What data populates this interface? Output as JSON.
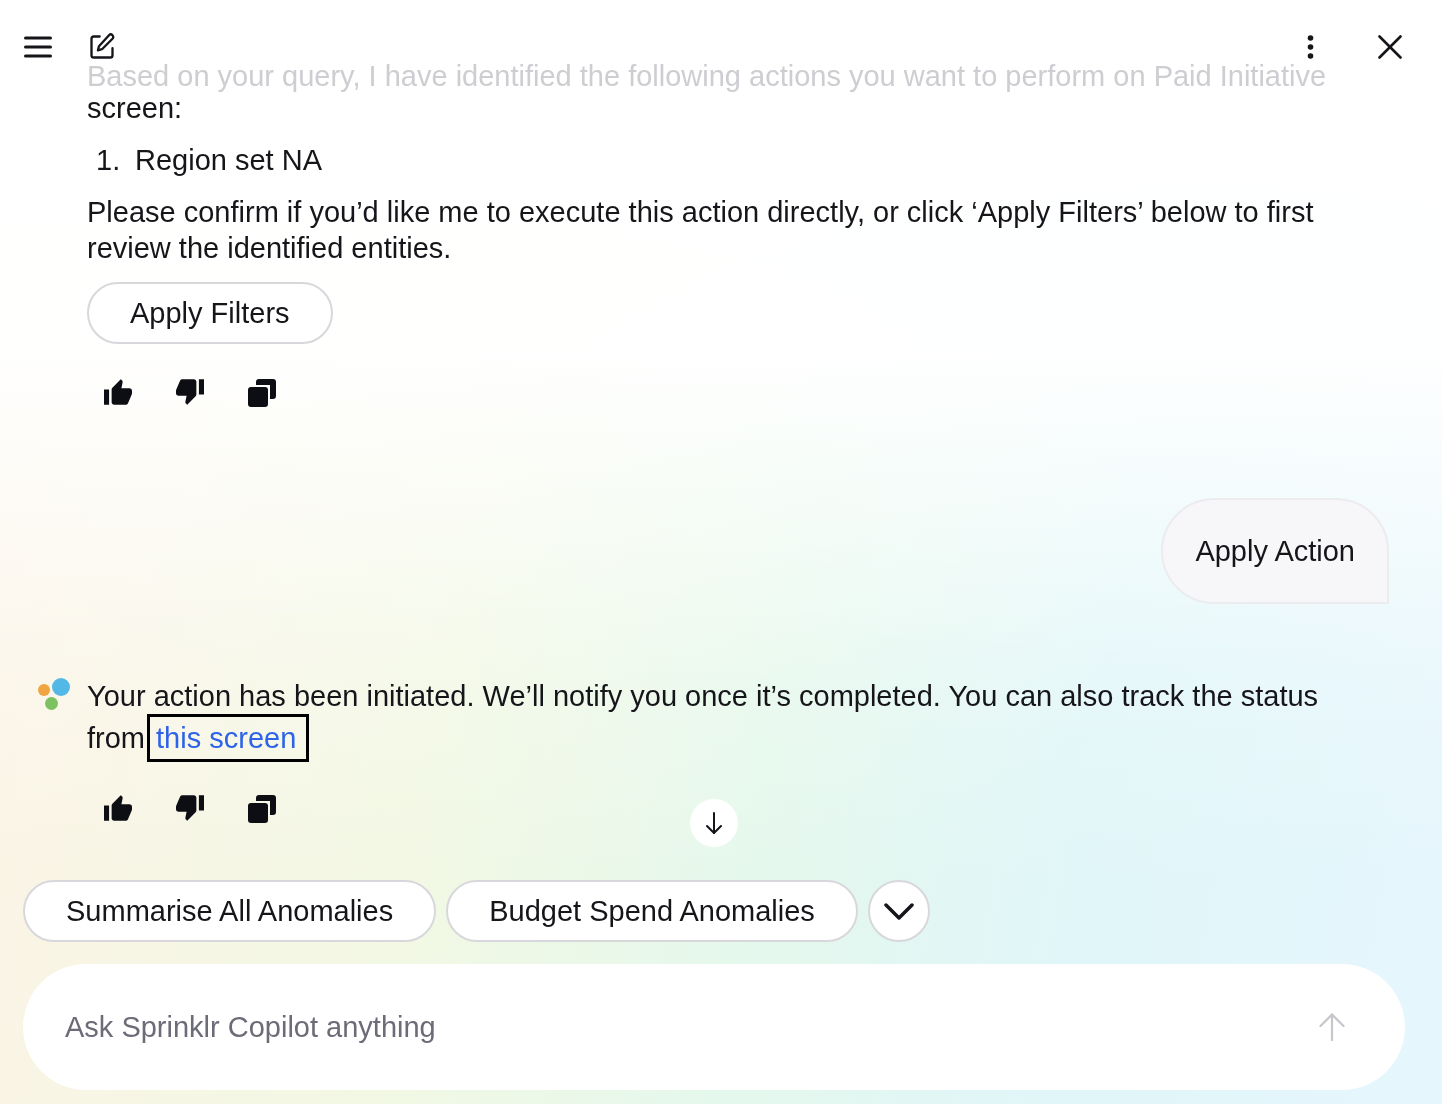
{
  "messages": [
    {
      "kind": "assistant",
      "show_logo": false,
      "cut_off_line": "Based on your query, I have identified the following actions you want to perform on Paid Initiative",
      "intro": "screen:",
      "list": [
        {
          "number": "1.",
          "text": "Region set NA"
        }
      ],
      "text": "Please confirm if you’d like me to execute this action directly, or click ‘Apply Filters’ below to first review the identified entities.",
      "button": "Apply Filters"
    },
    {
      "kind": "user",
      "text": "Apply Action"
    },
    {
      "kind": "assistant",
      "show_logo": true,
      "text": "Your action has been initiated. We’ll notify you once it’s completed. You can also track the status from",
      "link": {
        "text": "this screen",
        "focused": true
      }
    }
  ],
  "suggestions": [
    {
      "label": "Summarise All Anomalies"
    },
    {
      "label": "Budget Spend Anomalies"
    }
  ],
  "input": {
    "placeholder": "Ask Sprinklr Copilot anything"
  }
}
